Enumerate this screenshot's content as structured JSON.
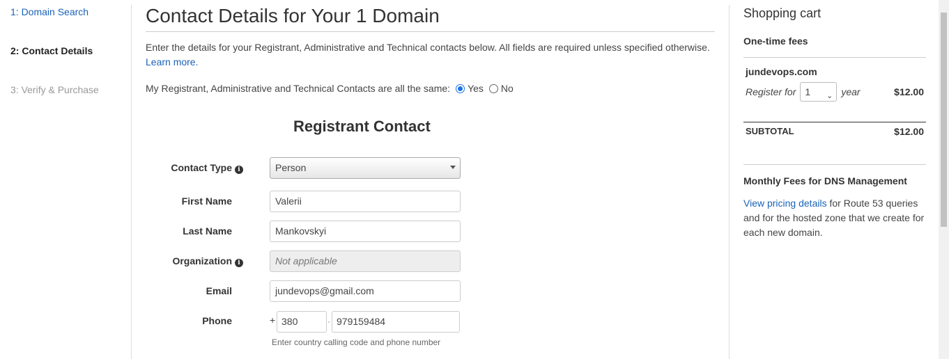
{
  "steps": [
    {
      "label": "1: Domain Search"
    },
    {
      "label": "2: Contact Details"
    },
    {
      "label": "3: Verify & Purchase"
    }
  ],
  "main": {
    "title": "Contact Details for Your 1 Domain",
    "intro": "Enter the details for your Registrant, Administrative and Technical contacts below. All fields are required unless specified otherwise.",
    "learn_more": "Learn more.",
    "same_question": "My Registrant, Administrative and Technical Contacts are all the same:",
    "yes_label": "Yes",
    "no_label": "No",
    "same_selected": "Yes",
    "section_title": "Registrant Contact"
  },
  "form": {
    "contact_type": {
      "label": "Contact Type",
      "value": "Person"
    },
    "first_name": {
      "label": "First Name",
      "value": "Valerii"
    },
    "last_name": {
      "label": "Last Name",
      "value": "Mankovskyi"
    },
    "organization": {
      "label": "Organization",
      "placeholder": "Not applicable"
    },
    "email": {
      "label": "Email",
      "value": "jundevops@gmail.com"
    },
    "phone": {
      "label": "Phone",
      "plus": "+",
      "country_code": "380",
      "separator": "·",
      "number": "979159484",
      "help": "Enter country calling code and phone number"
    }
  },
  "cart": {
    "title": "Shopping cart",
    "one_time_fees": "One-time fees",
    "domain": "jundevops.com",
    "register_for": "Register for",
    "years": "1",
    "year_label": "year",
    "price": "$12.00",
    "subtotal_label": "SUBTOTAL",
    "subtotal": "$12.00",
    "monthly_title": "Monthly Fees for DNS Management",
    "pricing_link": "View pricing details",
    "pricing_text": " for Route 53 queries and for the hosted zone that we create for each new domain."
  },
  "colors": {
    "link": "#1a62b7",
    "radio_accent": "#1a73e8"
  }
}
